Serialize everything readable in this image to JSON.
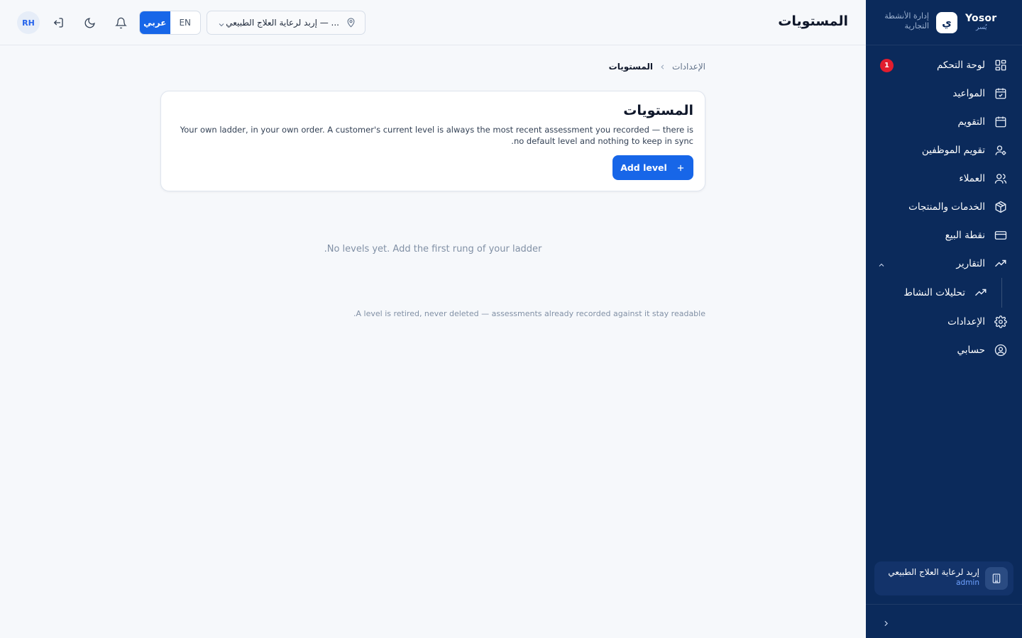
{
  "brand": {
    "name": "Yosor",
    "name_ar": "يُسر",
    "tagline": "إدارة الأنشطة التجارية",
    "logo_glyph": "ي"
  },
  "sidebar": {
    "items": [
      {
        "label": "لوحة التحكم",
        "icon": "dashboard-grid-icon",
        "badge": "1"
      },
      {
        "label": "المواعيد",
        "icon": "calendar-check-icon"
      },
      {
        "label": "التقويم",
        "icon": "calendar-icon"
      },
      {
        "label": "تقويم الموظفين",
        "icon": "user-gear-icon"
      },
      {
        "label": "العملاء",
        "icon": "users-icon"
      },
      {
        "label": "الخدمات والمنتجات",
        "icon": "box-icon"
      },
      {
        "label": "نقطة البيع",
        "icon": "credit-card-icon"
      },
      {
        "label": "التقارير",
        "icon": "trending-up-icon",
        "expanded": true
      },
      {
        "label": "الإعدادات",
        "icon": "gear-icon"
      },
      {
        "label": "حسابي",
        "icon": "user-circle-icon"
      }
    ],
    "sub_items": [
      {
        "label": "تحليلات النشاط",
        "icon": "trending-up-icon"
      }
    ],
    "org": {
      "name": "إربد لرعاية العلاج الطبيعي",
      "role": "admin"
    }
  },
  "header": {
    "title": "المستويات",
    "avatar_initials": "RH",
    "lang_en": "EN",
    "lang_ar": "عربي",
    "location": "إربد لرعاية العلاج الطبيعي — ..."
  },
  "breadcrumb": {
    "parent": "الإعدادات",
    "current": "المستويات"
  },
  "card": {
    "title": "المستويات",
    "description": "Your own ladder, in your own order. A customer's current level is always the most recent assessment you recorded — there is no default level and nothing to keep in sync.",
    "add_button": "Add level"
  },
  "empty_state": "No levels yet. Add the first rung of your ladder.",
  "footnote": "A level is retired, never deleted — assessments already recorded against it stay readable.",
  "colors": {
    "sidebar_bg": "#0b2a5b",
    "accent": "#1766e8",
    "badge": "#e11d2e"
  }
}
